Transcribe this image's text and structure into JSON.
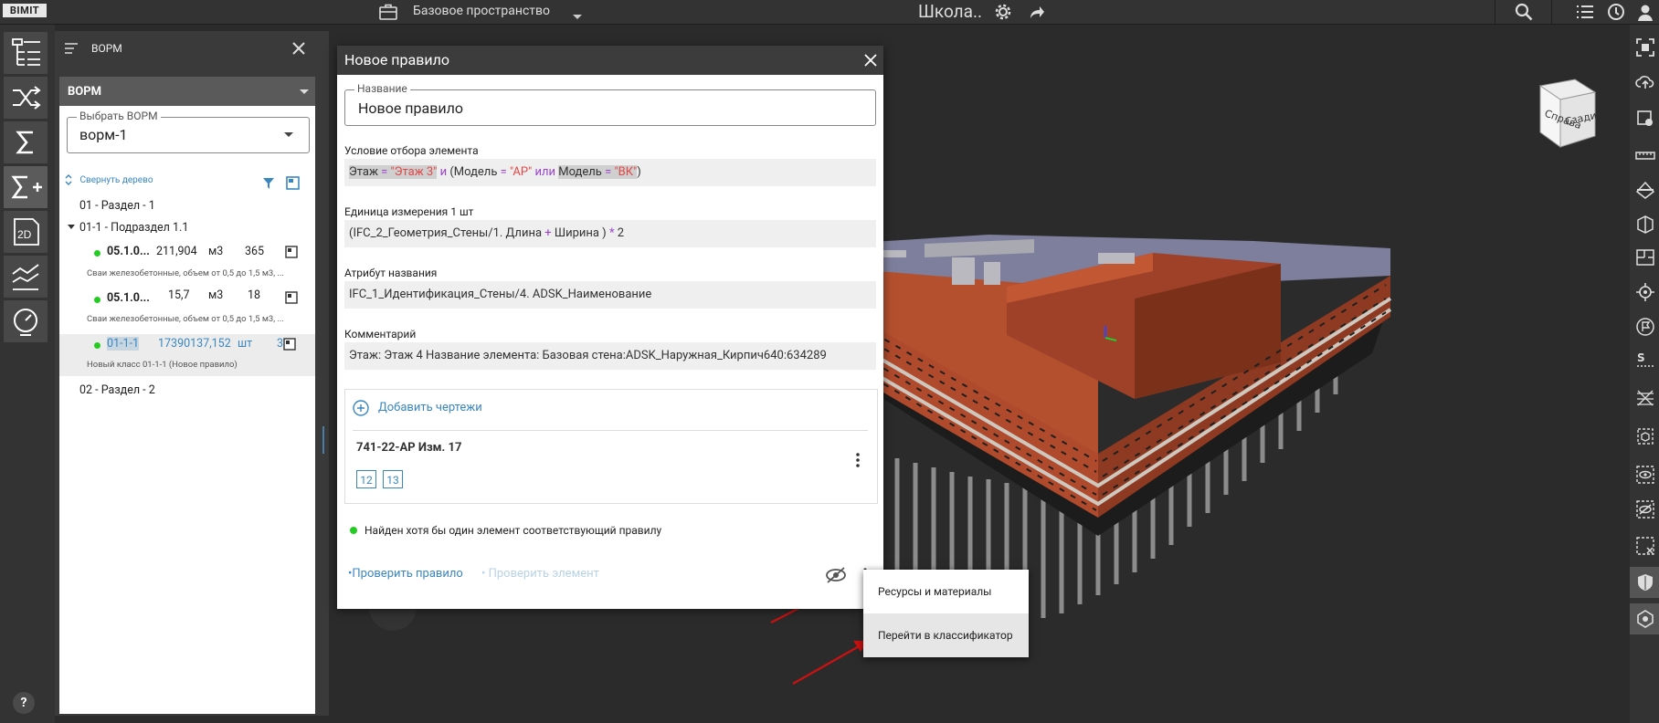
{
  "app": {
    "logo": "BIMIT",
    "workspace": "Базовое пространство",
    "project_title": "Школа.."
  },
  "panel": {
    "title": "ВОРМ",
    "section_select": "ВОРМ",
    "vorm_field": {
      "label": "Выбрать ВОРМ",
      "value": "ворм-1"
    },
    "collapse_label": "Свернуть дерево",
    "tree": {
      "section1": "01 - Раздел - 1",
      "subsection1": "01-1 - Подраздел 1.1",
      "items": [
        {
          "code": "05.1.0...",
          "value": "211,904",
          "unit": "м3",
          "count": "365",
          "desc": "Сваи железобетонные, объем от 0,5 до 1,5 м3, ..."
        },
        {
          "code": "05.1.0...",
          "value": "15,7",
          "unit": "м3",
          "count": "18",
          "desc": "Сваи железобетонные, объем от 0,5 до 1,5 м3, ..."
        },
        {
          "code": "01-1-1",
          "value": "17390137,152",
          "unit": "шт",
          "count": "3",
          "desc": "Новый класс 01-1-1 (Новое правило)"
        }
      ],
      "section2": "02 - Раздел - 2"
    }
  },
  "modal": {
    "title": "Новое правило",
    "name_label": "Название",
    "name_value": "Новое правило",
    "condition_label": "Условие отбора элемента",
    "condition": {
      "t1": "Этаж",
      "op1": " = ",
      "v1": "\"Этаж 3\"",
      "and": " и ",
      "t2": "(Модель",
      "op2": " = ",
      "v2": "\"АР\"",
      "or": " или ",
      "t3": "Модель",
      "op3": " = ",
      "v3": "\"ВК\"",
      "close": ")"
    },
    "unit_label": "Единица измерения 1 шт",
    "unit_formula": {
      "p1": "(IFC_2_Геометрия_Стены/1. Длина ",
      "plus": "+",
      "p2": " Ширина ) ",
      "mul": "*",
      "p3": " 2"
    },
    "attr_label": "Атрибут названия",
    "attr_value": "IFC_1_Идентификация_Стены/4. ADSK_Наименование",
    "comment_label": "Комментарий",
    "comment_value": "Этаж: Этаж 4 Название элемента: Базовая стена:ADSK_Наружная_Кирпич640:634289",
    "add_drawings": "Добавить чертежи",
    "drawing_title": "741-22-АР Изм. 17",
    "sheets": [
      "12",
      "13"
    ],
    "status_text": "Найден хотя бы один элемент соответствующий правилу",
    "check_rule": "•Проверить правило",
    "check_element": "• Проверить элемент"
  },
  "context_menu": {
    "items": [
      "Ресурсы и материалы",
      "Перейти в классификатор"
    ]
  },
  "viewcube": {
    "left": "Справа",
    "right": "Сзади"
  },
  "help": "?",
  "colors": {
    "accent": "#3a87c0",
    "status_green": "#22cc22",
    "arrow_red": "#cc1111",
    "brick": "#b04a2c"
  }
}
